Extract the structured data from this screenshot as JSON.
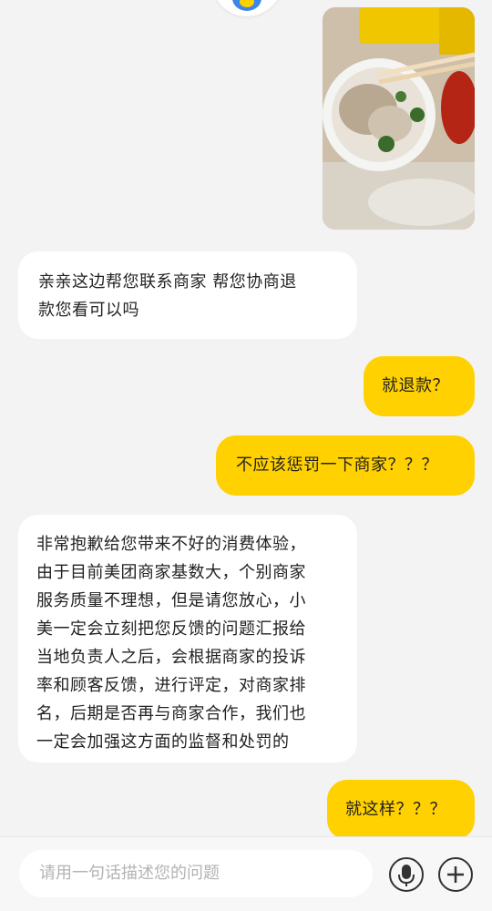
{
  "messages": [
    {
      "side": "right",
      "type": "image",
      "icon": "food-photo"
    },
    {
      "side": "left",
      "type": "text",
      "lines": [
        "亲亲这边帮您联系商家  帮您协商退",
        "款您看可以吗"
      ]
    },
    {
      "side": "right",
      "type": "text",
      "text": "就退款？"
    },
    {
      "side": "right",
      "type": "text",
      "text": "不应该惩罚一下商家？？？"
    },
    {
      "side": "left",
      "type": "text",
      "lines": [
        "非常抱歉给您带来不好的消费体验，",
        "由于目前美团商家基数大，个别商家",
        "服务质量不理想，但是请您放心，小",
        "美一定会立刻把您反馈的问题汇报给",
        "当地负责人之后，会根据商家的投诉",
        "率和顾客反馈，进行评定，对商家排",
        "名，后期是否再与商家合作，我们也",
        "一定会加强这方面的监督和处罚的"
      ]
    },
    {
      "side": "right",
      "type": "text",
      "text": "就这样？？？"
    }
  ],
  "input": {
    "placeholder": "请用一句话描述您的问题"
  },
  "icons": {
    "mic": "microphone-icon",
    "plus": "plus-icon",
    "avatar": "avatar-icon"
  },
  "colors": {
    "user_bubble": "#ffd100",
    "agent_bubble": "#ffffff",
    "background": "#f3f3f3"
  }
}
